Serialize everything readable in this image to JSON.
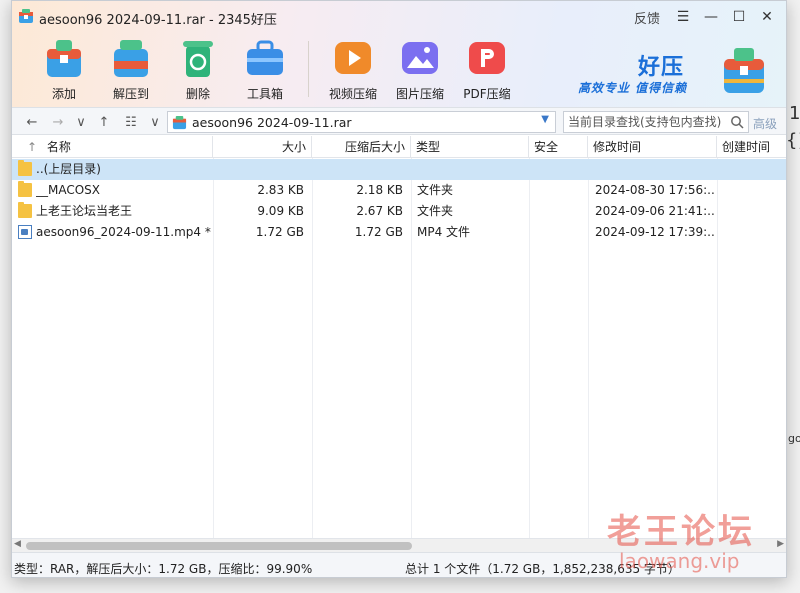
{
  "window": {
    "title": "aesoon96 2024-09-11.rar - 2345好压",
    "feedback_label": "反馈",
    "menu_glyph": "☰",
    "minimize_glyph": "—",
    "maximize_glyph": "☐",
    "close_glyph": "✕"
  },
  "toolbar": {
    "items": [
      {
        "label": "添加",
        "icon": "add-archive-icon",
        "color": "#e85b3b"
      },
      {
        "label": "解压到",
        "icon": "extract-to-icon",
        "color": "#3aa0e6"
      },
      {
        "label": "删除",
        "icon": "recycle-delete-icon",
        "color": "#2fb37a"
      },
      {
        "label": "工具箱",
        "icon": "toolbox-icon",
        "color": "#3a8ee6"
      },
      {
        "label": "视频压缩",
        "icon": "video-compress-icon",
        "color": "#f08a2a"
      },
      {
        "label": "图片压缩",
        "icon": "image-compress-icon",
        "color": "#7b6ff0"
      },
      {
        "label": "PDF压缩",
        "icon": "pdf-compress-icon",
        "color": "#ef4b4b"
      }
    ]
  },
  "brand": {
    "name": "好压",
    "slogan": "高效专业  值得信赖"
  },
  "addressbar": {
    "path": "aesoon96 2024-09-11.rar",
    "search_placeholder": "当前目录查找(支持包内查找)",
    "advanced_label": "高级"
  },
  "columns": {
    "name": "名称",
    "size": "大小",
    "packed": "压缩后大小",
    "type": "类型",
    "security": "安全",
    "modified": "修改时间",
    "created": "创建时间",
    "sort_arrow": "↑"
  },
  "rows": [
    {
      "name": "..(上层目录)",
      "size": "",
      "packed": "",
      "type": "",
      "modified": "",
      "icon": "folder-icon",
      "selected": true
    },
    {
      "name": "__MACOSX",
      "size": "2.83 KB",
      "packed": "2.18 KB",
      "type": "文件夹",
      "modified": "2024-08-30 17:56:...",
      "icon": "folder-icon",
      "selected": false
    },
    {
      "name": "上老王论坛当老王",
      "size": "9.09 KB",
      "packed": "2.67 KB",
      "type": "文件夹",
      "modified": "2024-09-06 21:41:...",
      "icon": "folder-icon",
      "selected": false
    },
    {
      "name": "aesoon96_2024-09-11.mp4 *",
      "size": "1.72 GB",
      "packed": "1.72 GB",
      "type": "MP4 文件",
      "modified": "2024-09-12 17:39:...",
      "icon": "video-file-icon",
      "selected": false
    }
  ],
  "status": {
    "left": "类型：RAR，解压后大小：1.72 GB，压缩比：99.90%",
    "right": "总计 1 个文件（1.72 GB，1,852,238,635 字节）"
  },
  "watermark": {
    "line1": "老王论坛",
    "line2": "laowang.vip"
  },
  "background_fragments": {
    "a": "1",
    "b": "{}",
    "c": "gol"
  }
}
